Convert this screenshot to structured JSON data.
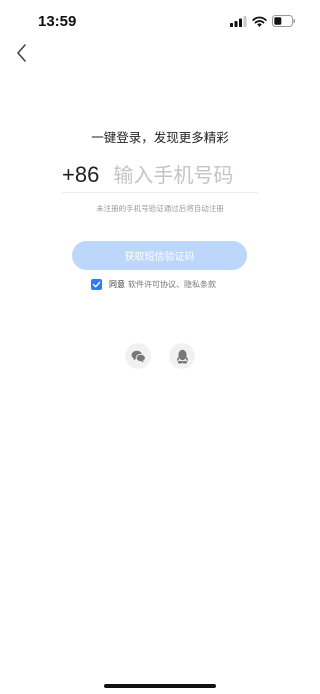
{
  "status_bar": {
    "time": "13:59",
    "icons": [
      "cellular-signal-icon",
      "wifi-icon",
      "battery-icon"
    ]
  },
  "nav": {
    "back_icon": "chevron-left-icon"
  },
  "login": {
    "headline": "一键登录，发现更多精彩",
    "country_code": "+86",
    "phone_placeholder": "输入手机号码",
    "phone_value": "",
    "hint": "未注册的手机号验证通过后将自动注册",
    "sms_button_label": "获取短信验证码",
    "agree_checked": true,
    "agree_label": "同意",
    "terms_label": "软件许可协议、隐私条款"
  },
  "social_login": [
    {
      "icon": "wechat-icon"
    },
    {
      "icon": "qq-icon"
    }
  ],
  "colors": {
    "accent": "#2f7cf6",
    "button_disabled": "#bcd7fb",
    "placeholder": "#c4c4c4",
    "hint": "#9a9a9a"
  }
}
